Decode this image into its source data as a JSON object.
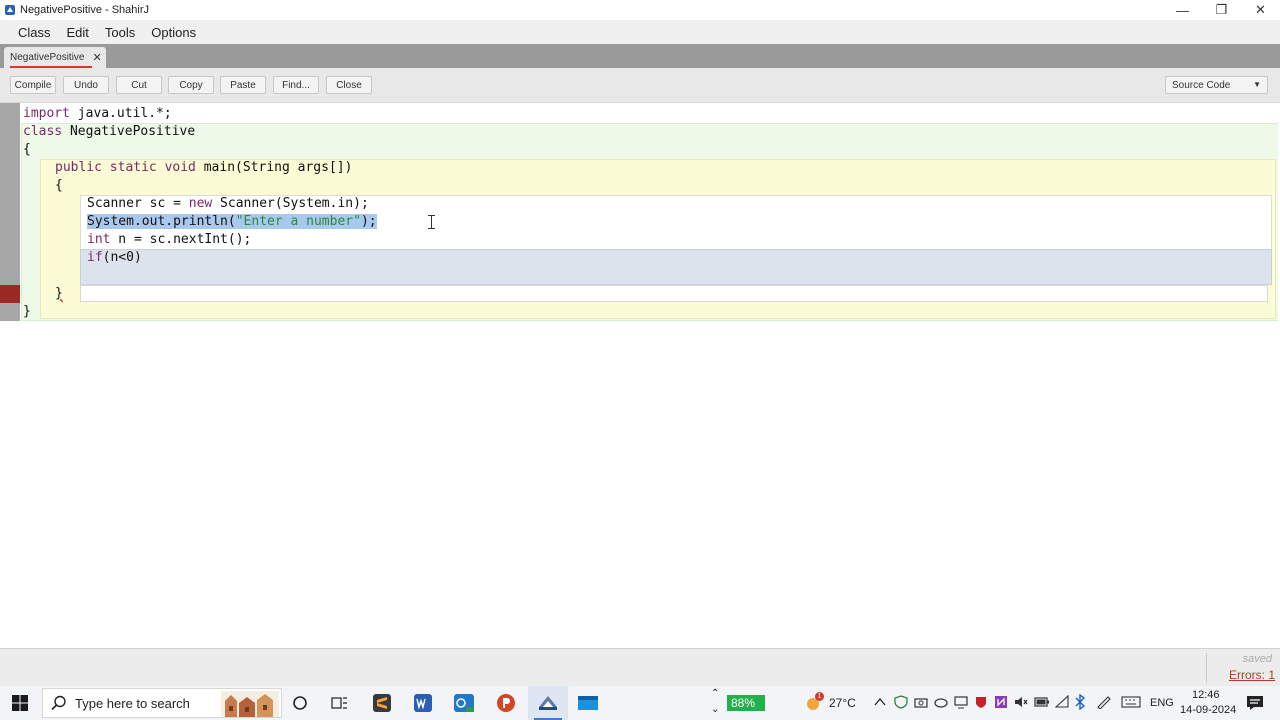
{
  "window": {
    "title": "NegativePositive - ShahirJ",
    "minimize_glyph": "—",
    "restore_glyph": "❐",
    "close_glyph": "✕"
  },
  "menu": [
    "Class",
    "Edit",
    "Tools",
    "Options"
  ],
  "tab": {
    "label": "NegativePositive",
    "close_glyph": "✕"
  },
  "toolbar": {
    "buttons": [
      "Compile",
      "Undo",
      "Cut",
      "Copy",
      "Paste",
      "Find...",
      "Close"
    ],
    "view_select": "Source Code",
    "view_select_chevron": "▼"
  },
  "code": {
    "line1_kw": "import",
    "line1_rest": " java.util.*;",
    "line2_kw": "class",
    "line2_rest": " NegativePositive",
    "line3": "{",
    "line4_kw": "public static void",
    "line4_rest": " main(String args[])",
    "line5": "{",
    "line6_a": "Scanner sc = ",
    "line6_kw": "new",
    "line6_b": " Scanner(System.in);",
    "line7_a": "System.out.println(",
    "line7_str": "\"Enter a number\"",
    "line7_b": ");",
    "line8_kw": "int",
    "line8_rest": " n = sc.nextInt();",
    "line9_kw": "if",
    "line9_rest": "(n<0)",
    "line11": "}",
    "line12": "}"
  },
  "status": {
    "saved": "saved",
    "errors": "Errors: 1"
  },
  "taskbar": {
    "search_placeholder": "Type here to search",
    "battery": "88%",
    "weather_badge": "1",
    "temperature": "27°C",
    "language": "ENG",
    "time": "12:46",
    "date": "14-09-2024",
    "tray_up": "⌃",
    "tray_down": "⌄"
  },
  "colors": {
    "accent_tab_underline": "#d63a2a",
    "error_marker": "#9b2a24",
    "selection": "#a8c8ee",
    "class_scope": "#eef9e8",
    "method_scope": "#fbfbd5",
    "if_scope": "#dde3ec"
  }
}
